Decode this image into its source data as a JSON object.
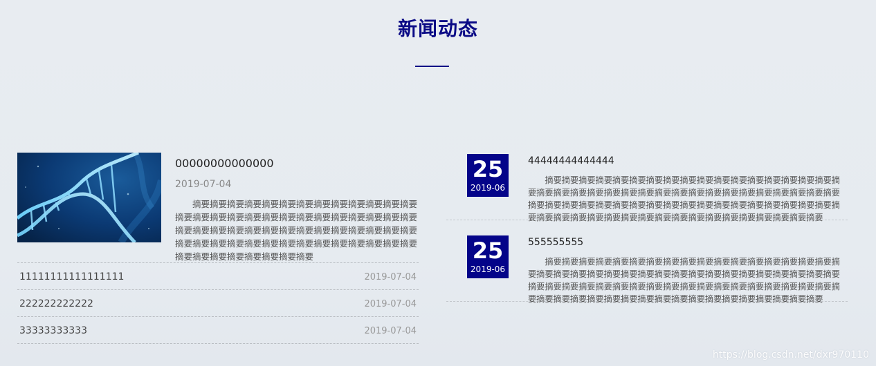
{
  "section": {
    "title": "新闻动态"
  },
  "featured": {
    "title": "00000000000000",
    "date": "2019-07-04",
    "summary": "摘要摘要摘要摘要摘要摘要摘要摘要摘要摘要摘要摘要摘要摘要摘要摘要摘要摘要摘要摘要摘要摘要摘要摘要摘要摘要摘要摘要摘要摘要摘要摘要摘要摘要摘要摘要摘要摘要摘要摘要摘要摘要摘要摘要摘要摘要摘要摘要摘要摘要摘要摘要摘要摘要摘要摘要摘要摘要摘要摘要摘要摘要摘要",
    "image_icon": "dna-helix-image"
  },
  "left_list": [
    {
      "title": "11111111111111111",
      "date": "2019-07-04"
    },
    {
      "title": "222222222222",
      "date": "2019-07-04"
    },
    {
      "title": "33333333333",
      "date": "2019-07-04"
    }
  ],
  "right_list": [
    {
      "day": "25",
      "year_month": "2019-06",
      "title": "44444444444444",
      "summary": "摘要摘要摘要摘要摘要摘要摘要摘要摘要摘要摘要摘要摘要摘要摘要摘要摘要摘要摘要摘要摘要摘要摘要摘要摘要摘要摘要摘要摘要摘要摘要摘要摘要摘要摘要摘要摘要摘要摘要摘要摘要摘要摘要摘要摘要摘要摘要摘要摘要摘要摘要摘要摘要摘要摘要摘要摘要摘要摘要摘要摘要摘要摘要摘要摘要摘要摘要摘要摘要摘要摘要摘要"
    },
    {
      "day": "25",
      "year_month": "2019-06",
      "title": "555555555",
      "summary": "摘要摘要摘要摘要摘要摘要摘要摘要摘要摘要摘要摘要摘要摘要摘要摘要摘要摘要摘要摘要摘要摘要摘要摘要摘要摘要摘要摘要摘要摘要摘要摘要摘要摘要摘要摘要摘要摘要摘要摘要摘要摘要摘要摘要摘要摘要摘要摘要摘要摘要摘要摘要摘要摘要摘要摘要摘要摘要摘要摘要摘要摘要摘要摘要摘要摘要摘要摘要摘要摘要摘要摘要"
    }
  ],
  "watermark": "https://blog.csdn.net/dxr970110",
  "colors": {
    "accent": "#0b0b86",
    "date_block": "#040489"
  }
}
